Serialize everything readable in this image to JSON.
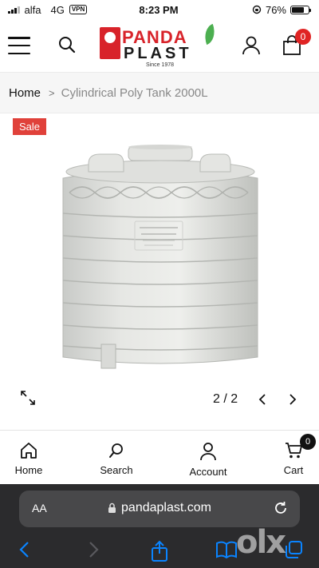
{
  "status_bar": {
    "carrier": "alfa",
    "network": "4G",
    "vpn": "VPN",
    "time": "8:23 PM",
    "battery": "76%",
    "battery_level": 0.76
  },
  "header": {
    "logo_top": "PANDA",
    "logo_bottom": "PLAST",
    "logo_since": "Since 1978",
    "cart_count": "0"
  },
  "breadcrumb": {
    "home": "Home",
    "separator": ">",
    "current": "Cylindrical Poly Tank 2000L"
  },
  "gallery": {
    "badge": "Sale",
    "counter": "2 / 2",
    "image": "product-tank-image"
  },
  "bottom_nav": {
    "items": [
      {
        "label": "Home",
        "icon": "home-icon"
      },
      {
        "label": "Search",
        "icon": "search-icon"
      },
      {
        "label": "Account",
        "icon": "account-icon"
      },
      {
        "label": "Cart",
        "icon": "cart-icon",
        "badge": "0"
      }
    ]
  },
  "browser": {
    "aa": "AA",
    "url": "pandaplast.com"
  },
  "watermark": "olx",
  "colors": {
    "brand_red": "#d8232a",
    "sale_red": "#e0413a",
    "safari_bg": "#2b2b2d",
    "ios_blue": "#0a84ff"
  }
}
